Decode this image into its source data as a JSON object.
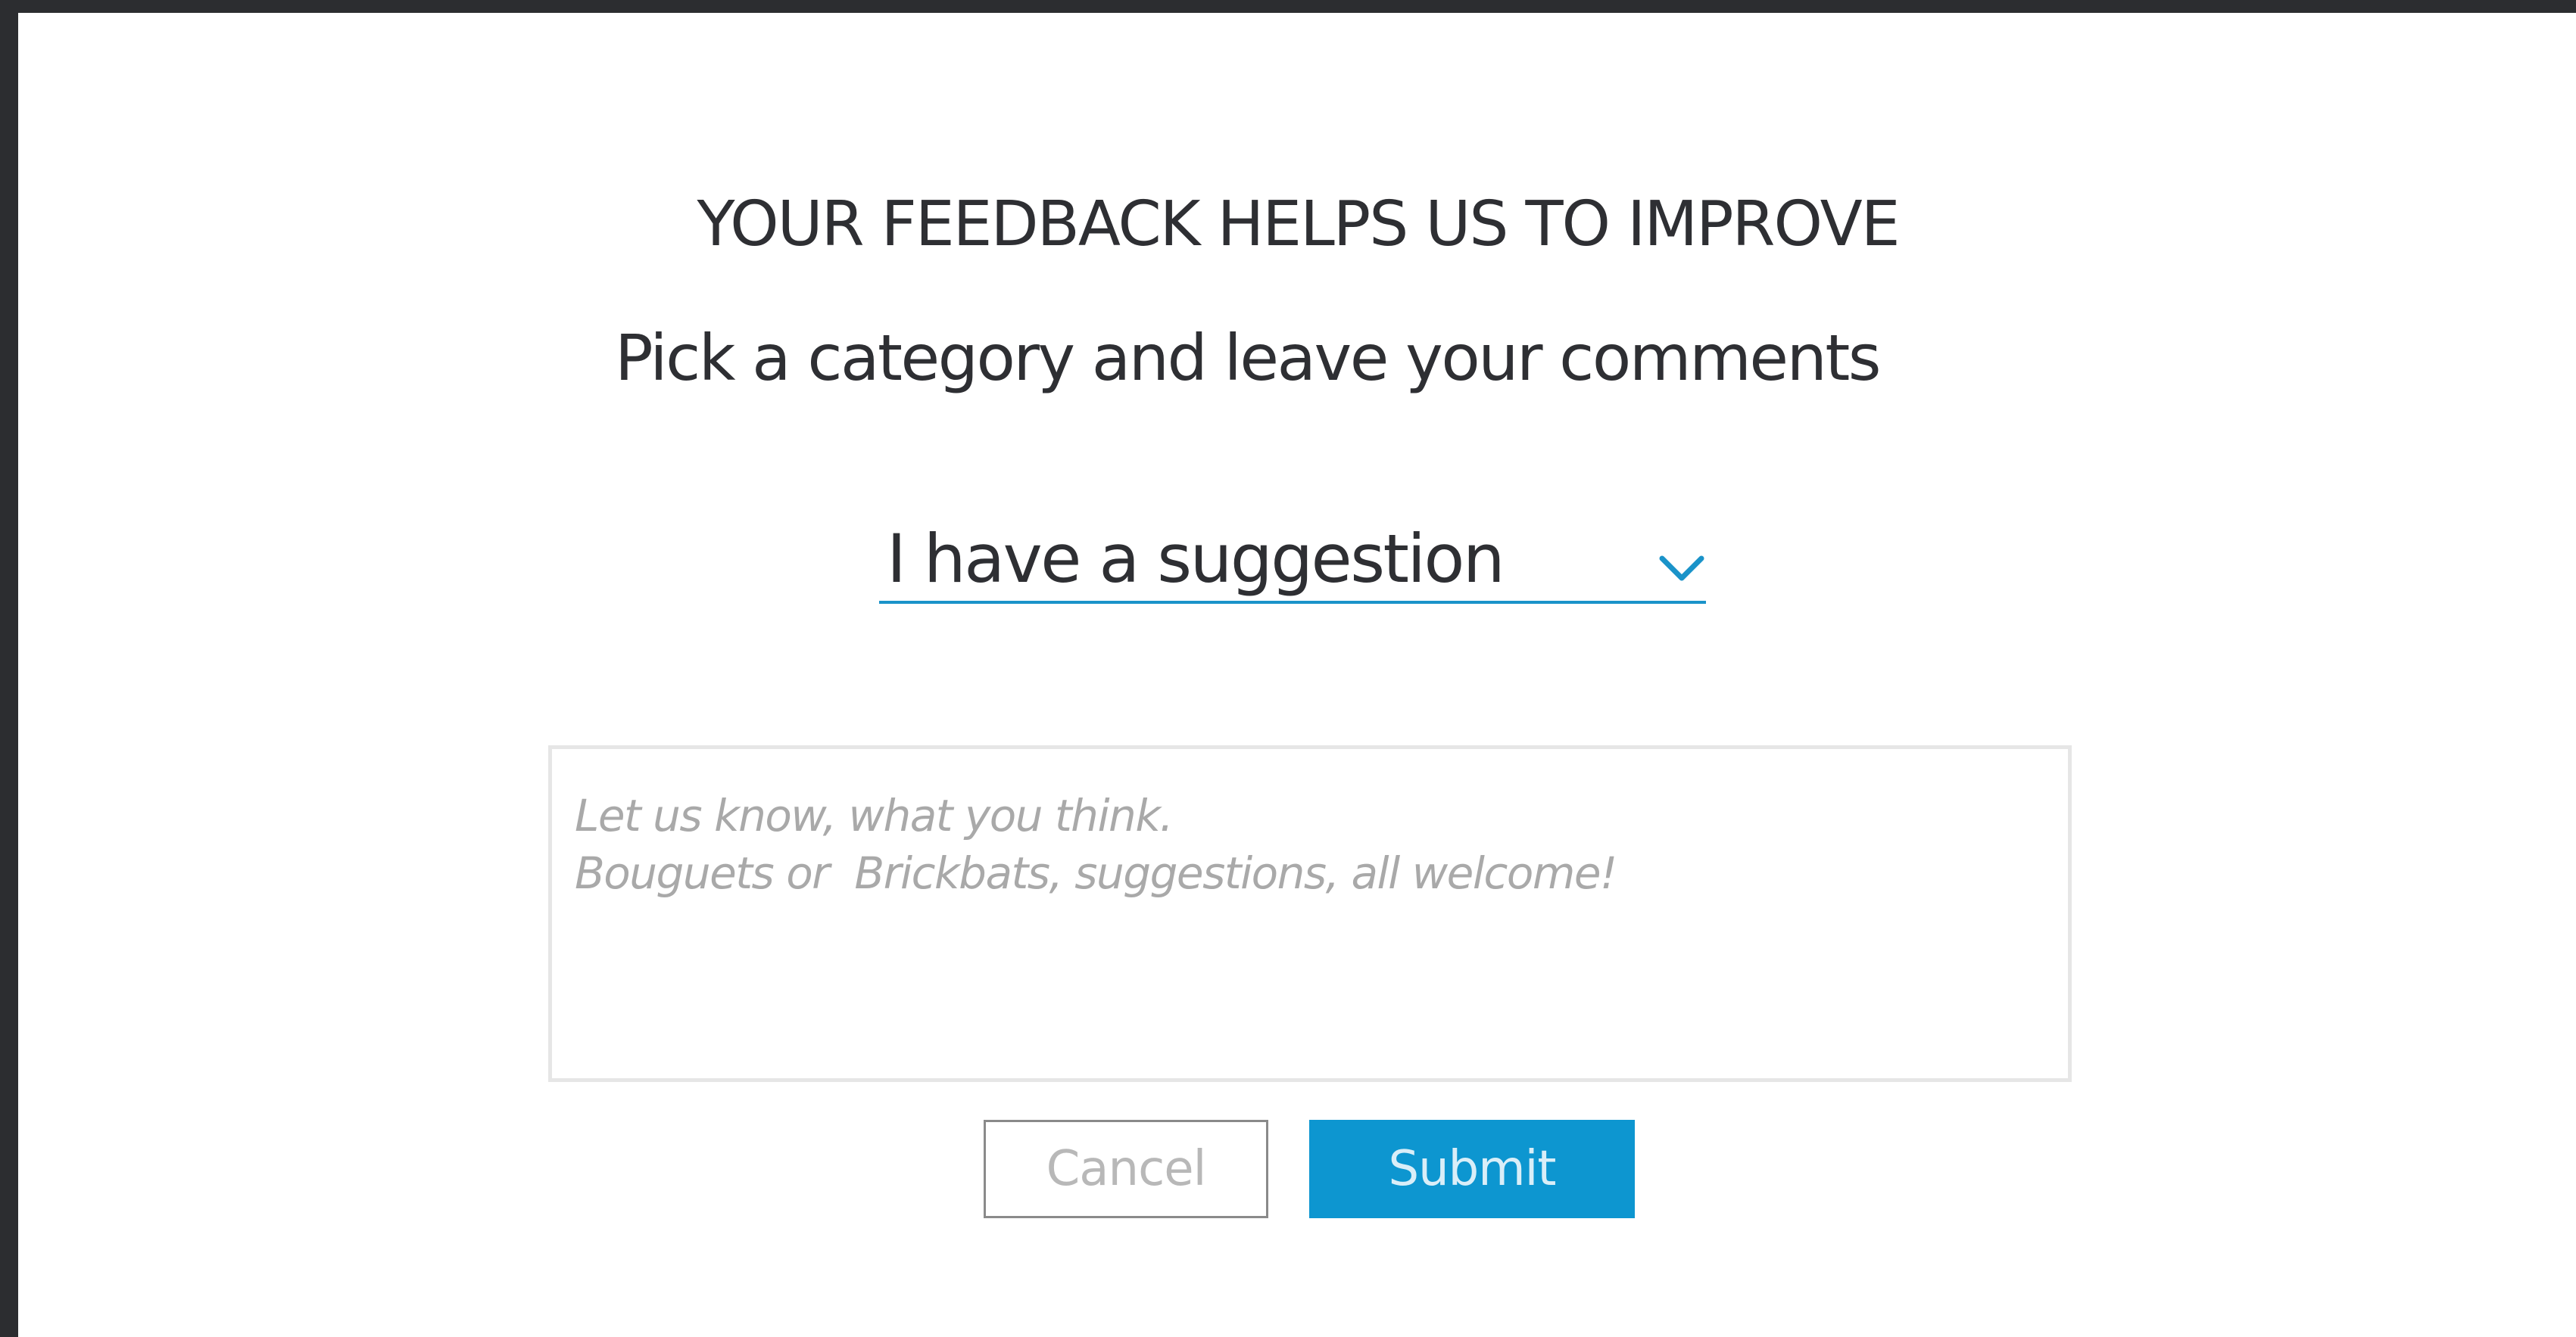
{
  "form": {
    "title": "YOUR FEEDBACK HELPS US TO IMPROVE",
    "subtitle": "Pick a category and leave your comments",
    "category": {
      "selected": "I have a suggestion",
      "icon": "chevron-down-icon"
    },
    "comment": {
      "placeholder": "Let us know, what you think.\nBouguets or  Brickbats, suggestions, all welcome!",
      "value": ""
    },
    "buttons": {
      "cancel_label": "Cancel",
      "submit_label": "Submit"
    }
  },
  "colors": {
    "accent": "#0d96d0",
    "underline": "#1a93c9",
    "text": "#2e2f33",
    "placeholder": "#a9a9a9",
    "frame": "#2c2d30"
  }
}
